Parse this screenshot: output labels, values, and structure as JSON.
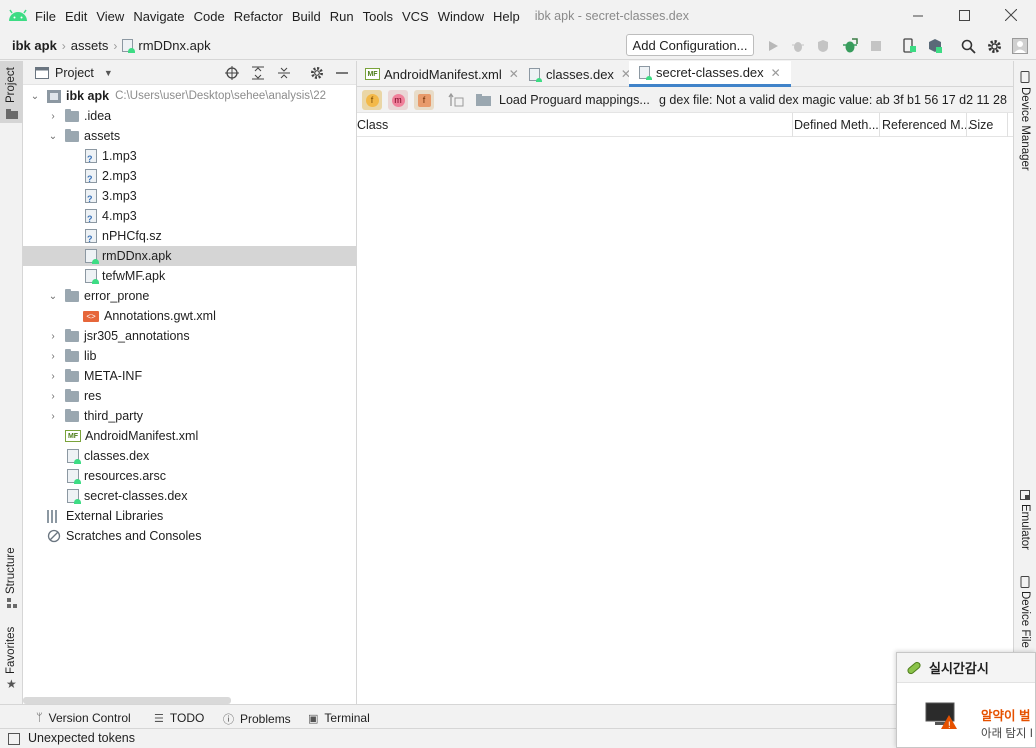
{
  "menubar": {
    "items": [
      "File",
      "Edit",
      "View",
      "Navigate",
      "Code",
      "Refactor",
      "Build",
      "Run",
      "Tools",
      "VCS",
      "Window",
      "Help"
    ],
    "window_title": "ibk apk - secret-classes.dex"
  },
  "navbar": {
    "crumbs": [
      "ibk apk",
      "assets",
      "rmDDnx.apk"
    ],
    "add_config": "Add Configuration..."
  },
  "left_stripe": {
    "project": "Project",
    "structure": "Structure",
    "favorites": "Favorites"
  },
  "project_panel": {
    "view_label": "Project",
    "root_name": "ibk apk",
    "root_path": "C:\\Users\\user\\Desktop\\sehee\\analysis\\22",
    "tree": [
      {
        "label": "ibk apk"
      },
      {
        "label": ".idea"
      },
      {
        "label": "assets"
      },
      {
        "label": "1.mp3"
      },
      {
        "label": "2.mp3"
      },
      {
        "label": "3.mp3"
      },
      {
        "label": "4.mp3"
      },
      {
        "label": "nPHCfq.sz"
      },
      {
        "label": "rmDDnx.apk"
      },
      {
        "label": "tefwMF.apk"
      },
      {
        "label": "error_prone"
      },
      {
        "label": "Annotations.gwt.xml"
      },
      {
        "label": "jsr305_annotations"
      },
      {
        "label": "lib"
      },
      {
        "label": "META-INF"
      },
      {
        "label": "res"
      },
      {
        "label": "third_party"
      },
      {
        "label": "AndroidManifest.xml"
      },
      {
        "label": "classes.dex"
      },
      {
        "label": "resources.arsc"
      },
      {
        "label": "secret-classes.dex"
      },
      {
        "label": "External Libraries"
      },
      {
        "label": "Scratches and Consoles"
      }
    ]
  },
  "editor": {
    "tabs": [
      {
        "label": "AndroidManifest.xml"
      },
      {
        "label": "classes.dex"
      },
      {
        "label": "secret-classes.dex"
      }
    ],
    "dex_toolbar": {
      "badges": [
        "f",
        "m",
        "f"
      ],
      "load_mappings": "Load Proguard mappings...",
      "error": "g dex file: Not a valid dex magic value: ab 3f b1 56 17 d2 11 28"
    },
    "table_columns": [
      "Class",
      "Defined Meth...",
      "Referenced M...",
      "Size"
    ]
  },
  "right_stripe": {
    "device_manager": "Device Manager",
    "emulator": "Emulator",
    "device_file": "Device File"
  },
  "bottom_bar": {
    "items": [
      "Version Control",
      "TODO",
      "Problems",
      "Terminal"
    ]
  },
  "status": {
    "text": "Unexpected tokens"
  },
  "popup": {
    "title": "실시간감시",
    "line1": "알약이 벌",
    "line2": "아래 탐지 I"
  },
  "colors": {
    "android_green": "#3ddc84",
    "tab_accent": "#4083c9",
    "selection": "#d5d5d5",
    "popup_alert": "#e65100"
  }
}
